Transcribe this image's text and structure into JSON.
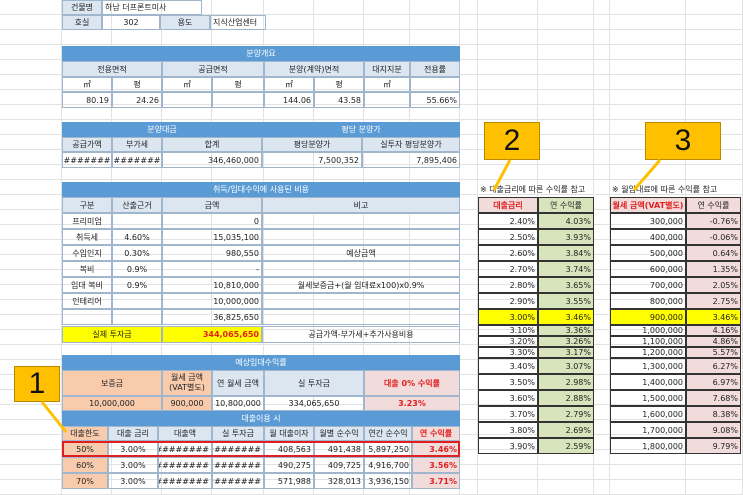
{
  "top": {
    "building_label": "건물명",
    "building_value": "하남 더프론트미사",
    "unit_label": "호실",
    "unit_value": "302",
    "use_label": "용도",
    "use_value": "지식산업센터"
  },
  "overview": {
    "title": "분양개요",
    "headers": [
      "전용면적",
      "공급면적",
      "분양(계약)면적",
      "대지지분",
      "전용률"
    ],
    "units": [
      "㎡",
      "평",
      "㎡",
      "평",
      "㎡",
      "평",
      "㎡"
    ],
    "values": [
      "80.19",
      "24.26",
      "",
      "",
      "144.06",
      "43.58",
      "",
      "55.66%"
    ]
  },
  "price": {
    "title_left": "분양대금",
    "title_right": "평당 분양가",
    "headers": [
      "공급가액",
      "부가세",
      "합계",
      "평당분양가",
      "실투자 평당분양가"
    ],
    "values": [
      "#########",
      "#########",
      "346,460,000",
      "7,500,352",
      "7,895,406"
    ]
  },
  "costs": {
    "title": "취득/임대수익에 사용된 비용",
    "headers": [
      "구분",
      "산출근거",
      "금액",
      "비고"
    ],
    "rows": [
      {
        "name": "프리미엄",
        "basis": "",
        "amount": "0",
        "note": ""
      },
      {
        "name": "취득세",
        "basis": "4.60%",
        "amount": "15,035,100",
        "note": ""
      },
      {
        "name": "수입인지",
        "basis": "0.30%",
        "amount": "980,550",
        "note": "예상금액"
      },
      {
        "name": "복비",
        "basis": "0.9%",
        "amount": "-",
        "note": ""
      },
      {
        "name": "임대 복비",
        "basis": "0.9%",
        "amount": "10,810,000",
        "note": "월세보증금+(월 임대료x100)x0.9%"
      },
      {
        "name": "인테리어",
        "basis": "",
        "amount": "10,000,000",
        "note": ""
      },
      {
        "name": "",
        "basis": "",
        "amount": "36,825,650",
        "note": ""
      }
    ],
    "actual_label": "실제 투자금",
    "actual_value": "344,065,650",
    "actual_note": "공급가액-부가세+추가사용비용"
  },
  "rent": {
    "title": "예상임대수익률",
    "headers": [
      "보증금",
      "월세 금액\n(VAT별도)",
      "연 월세 금액",
      "실 투자금",
      "대출 0% 수익률"
    ],
    "values": [
      "10,000,000",
      "900,000",
      "10,800,000",
      "334,065,650",
      "3.23%"
    ]
  },
  "loan": {
    "title": "대출이용 시",
    "headers": [
      "대출한도",
      "대출 금리",
      "대출액",
      "실 투자금",
      "월 대출이자",
      "월별 순수익",
      "연간 순수익",
      "연 수익률"
    ],
    "rows": [
      [
        "50%",
        "3.00%",
        "#########",
        "#########",
        "408,563",
        "491,438",
        "5,897,250",
        "3.46%"
      ],
      [
        "60%",
        "3.00%",
        "#########",
        "#########",
        "490,275",
        "409,725",
        "4,916,700",
        "3.56%"
      ],
      [
        "70%",
        "3.00%",
        "#########",
        "#########",
        "571,988",
        "328,013",
        "3,936,150",
        "3.71%"
      ]
    ]
  },
  "rate_table": {
    "note": "※ 대출금리에 따른 수익률 참고",
    "headers": [
      "대출금리",
      "연 수익률"
    ],
    "rows": [
      [
        "2.40%",
        "4.03%"
      ],
      [
        "2.50%",
        "3.93%"
      ],
      [
        "2.60%",
        "3.84%"
      ],
      [
        "2.70%",
        "3.74%"
      ],
      [
        "2.80%",
        "3.65%"
      ],
      [
        "2.90%",
        "3.55%"
      ],
      [
        "3.00%",
        "3.46%"
      ],
      [
        "3.10%",
        "3.36%"
      ],
      [
        "3.20%",
        "3.26%"
      ],
      [
        "3.30%",
        "3.17%"
      ],
      [
        "3.40%",
        "3.07%"
      ],
      [
        "3.50%",
        "2.98%"
      ],
      [
        "3.60%",
        "2.88%"
      ],
      [
        "3.70%",
        "2.79%"
      ],
      [
        "3.80%",
        "2.69%"
      ],
      [
        "3.90%",
        "2.59%"
      ]
    ]
  },
  "rent_table": {
    "note": "※ 월임대료에 따른 수익률 참고",
    "headers": [
      "월세 금액(VAT별도)",
      "연 수익률"
    ],
    "rows": [
      [
        "300,000",
        "-0.76%"
      ],
      [
        "400,000",
        "-0.06%"
      ],
      [
        "500,000",
        "0.64%"
      ],
      [
        "600,000",
        "1.35%"
      ],
      [
        "700,000",
        "2.05%"
      ],
      [
        "800,000",
        "2.75%"
      ],
      [
        "900,000",
        "3.46%"
      ],
      [
        "1,000,000",
        "4.16%"
      ],
      [
        "1,100,000",
        "4.86%"
      ],
      [
        "1,200,000",
        "5.57%"
      ],
      [
        "1,300,000",
        "6.27%"
      ],
      [
        "1,400,000",
        "6.97%"
      ],
      [
        "1,500,000",
        "7.68%"
      ],
      [
        "1,600,000",
        "8.38%"
      ],
      [
        "1,700,000",
        "9.08%"
      ],
      [
        "1,800,000",
        "9.79%"
      ]
    ]
  },
  "callouts": [
    "1",
    "2",
    "3"
  ]
}
